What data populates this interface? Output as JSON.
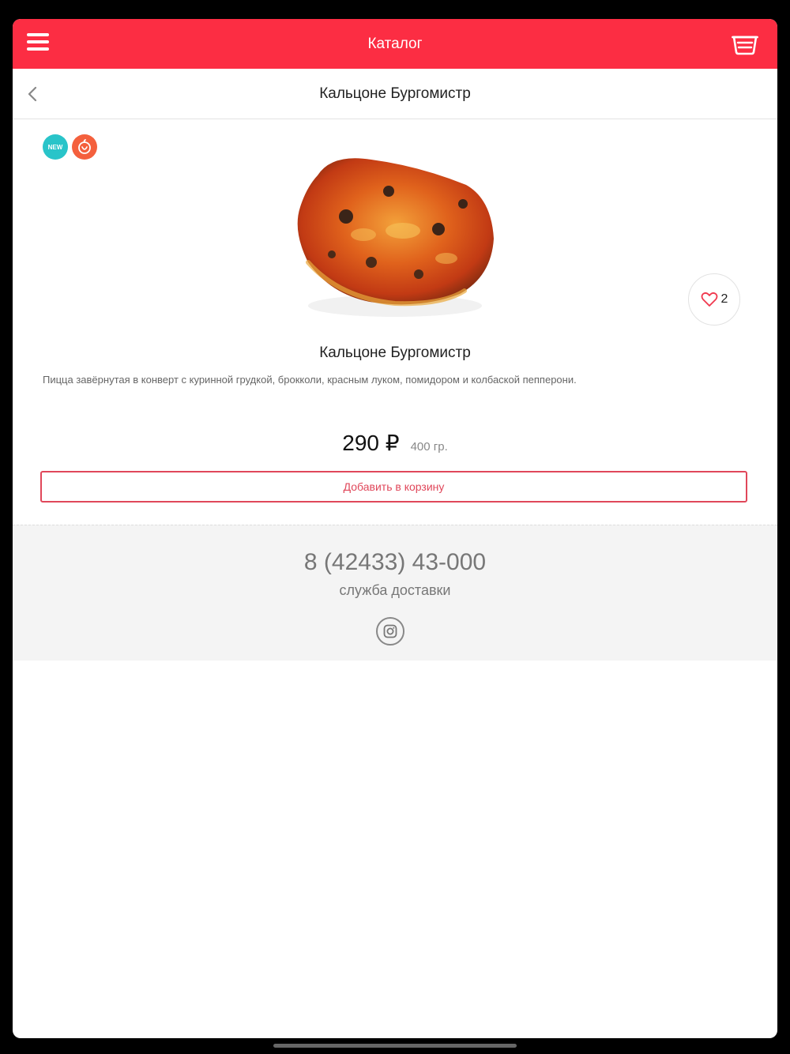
{
  "header": {
    "title": "Каталог",
    "menu_icon": "hamburger-menu-icon",
    "cart_icon": "basket-icon",
    "background_color": "#fc2d43"
  },
  "subheader": {
    "title": "Кальцоне Бургомистр",
    "back_icon": "chevron-left-icon"
  },
  "badges": {
    "new_label": "NEW",
    "spicy_icon": "chili-pepper-icon"
  },
  "product": {
    "image_icon": "calzone-image",
    "name": "Кальцоне Бургомистр",
    "description": "Пицца завёрнутая в конверт с куринной грудкой, брокколи, красным луком, помидором и колбаской пепперони.",
    "price": "290 ₽",
    "weight": "400 гр.",
    "likes": "2",
    "add_to_cart_label": "Добавить в корзину"
  },
  "footer": {
    "phone": "8 (42433) 43-000",
    "delivery_label": "служба доставки",
    "instagram_icon": "instagram-icon"
  },
  "colors": {
    "accent": "#fc2d43",
    "button_border": "#e0475a",
    "badge_new": "#29c4c9",
    "badge_spicy": "#f4603d"
  }
}
